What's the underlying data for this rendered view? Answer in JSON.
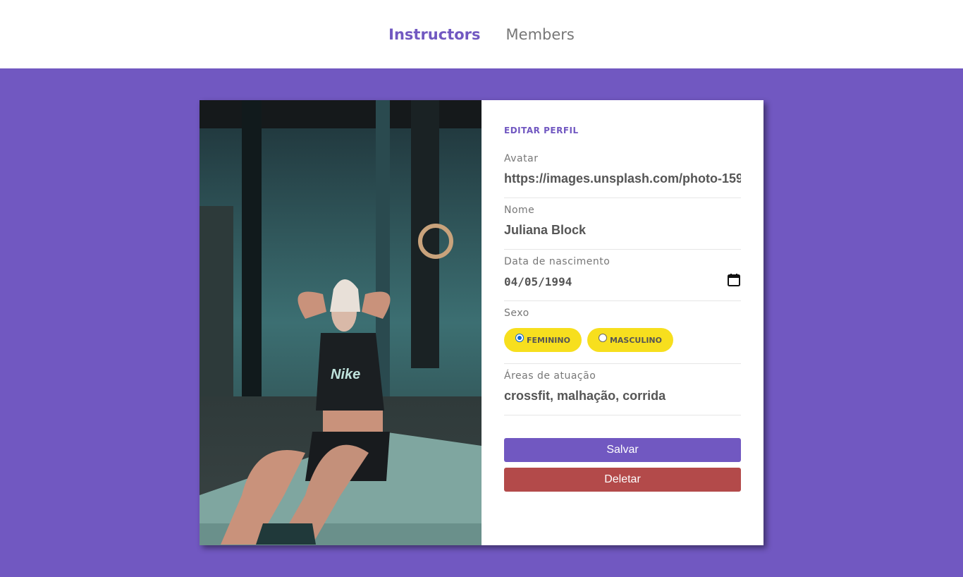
{
  "nav": {
    "links": [
      {
        "label": "Instructors",
        "active": true
      },
      {
        "label": "Members",
        "active": false
      }
    ]
  },
  "colors": {
    "primary": "#7158c1",
    "accent": "#f7df1e",
    "danger": "#b34a4a"
  },
  "form": {
    "title": "Editar perfil",
    "avatar": {
      "label": "Avatar",
      "value": "https://images.unsplash.com/photo-159"
    },
    "name": {
      "label": "Nome",
      "value": "Juliana Block"
    },
    "birth": {
      "label": "Data de nascimento",
      "value": "04/05/1994",
      "icon": "calendar-icon"
    },
    "gender": {
      "label": "Sexo",
      "options": [
        {
          "label": "Feminino",
          "checked": true
        },
        {
          "label": "Masculino",
          "checked": false
        }
      ]
    },
    "services": {
      "label": "Áreas de atuação",
      "value": "crossfit, malhação, corrida"
    },
    "save_label": "Salvar",
    "delete_label": "Deletar"
  }
}
